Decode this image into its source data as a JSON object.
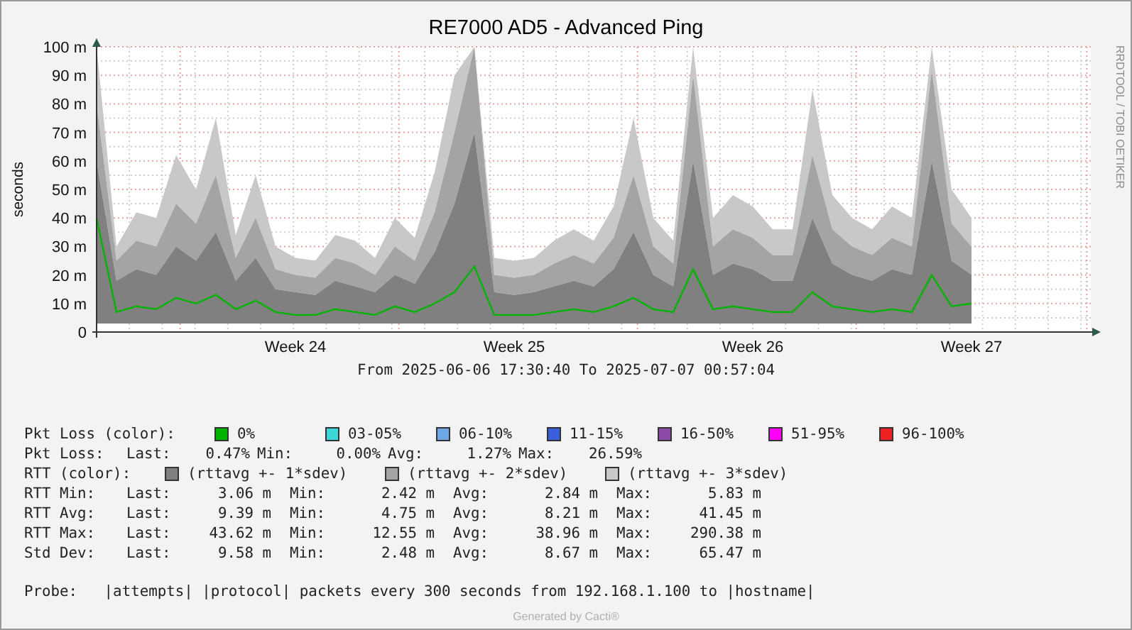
{
  "graph": {
    "title": "RE7000 AD5 - Advanced Ping",
    "side_credit": "RRDTOOL / TOBI OETIKER",
    "period": "From 2025-06-06 17:30:40 To 2025-07-07 00:57:04",
    "chart_data": {
      "type": "area",
      "ylabel": "seconds",
      "ylim": [
        0,
        100
      ],
      "grid": true,
      "yticks": [
        {
          "value": 0,
          "label": "0"
        },
        {
          "value": 10,
          "label": "10 m"
        },
        {
          "value": 20,
          "label": "20 m"
        },
        {
          "value": 30,
          "label": "30 m"
        },
        {
          "value": 40,
          "label": "40 m"
        },
        {
          "value": 50,
          "label": "50 m"
        },
        {
          "value": 60,
          "label": "60 m"
        },
        {
          "value": 70,
          "label": "70 m"
        },
        {
          "value": 80,
          "label": "80 m"
        },
        {
          "value": 90,
          "label": "90 m"
        },
        {
          "value": 100,
          "label": "100 m"
        }
      ],
      "categories": [
        null,
        null,
        null,
        null,
        null,
        null,
        null,
        null,
        null,
        null,
        "Week 24",
        null,
        null,
        null,
        null,
        null,
        null,
        null,
        null,
        null,
        null,
        "Week 25",
        null,
        null,
        null,
        null,
        null,
        null,
        null,
        null,
        null,
        null,
        null,
        "Week 26",
        null,
        null,
        null,
        null,
        null,
        null,
        null,
        null,
        null,
        null,
        "Week 27",
        null,
        null,
        null,
        null,
        null
      ],
      "series": [
        {
          "color": "#c8c8c8",
          "values": [
            100,
            30,
            42,
            40,
            62,
            50,
            75,
            34,
            55,
            30,
            26,
            25,
            34,
            32,
            26,
            40,
            33,
            56,
            90,
            100,
            26,
            25,
            26,
            32,
            36,
            32,
            44,
            75,
            40,
            32,
            100,
            40,
            48,
            44,
            36,
            36,
            85,
            48,
            40,
            36,
            44,
            40,
            100,
            50,
            40,
            null,
            null,
            null,
            null,
            null
          ]
        },
        {
          "color": "#a4a4a4",
          "values": [
            80,
            25,
            32,
            30,
            45,
            38,
            55,
            26,
            40,
            22,
            20,
            19,
            26,
            24,
            20,
            30,
            25,
            42,
            70,
            100,
            20,
            19,
            20,
            24,
            27,
            24,
            33,
            55,
            30,
            24,
            90,
            30,
            36,
            33,
            27,
            27,
            62,
            36,
            30,
            27,
            33,
            30,
            92,
            38,
            30,
            null,
            null,
            null,
            null,
            null
          ]
        },
        {
          "color": "#808080",
          "values": [
            60,
            18,
            22,
            20,
            30,
            25,
            35,
            18,
            26,
            15,
            14,
            13,
            18,
            16,
            14,
            20,
            17,
            28,
            45,
            70,
            14,
            13,
            14,
            16,
            18,
            16,
            22,
            35,
            20,
            16,
            60,
            20,
            24,
            22,
            18,
            18,
            40,
            24,
            20,
            18,
            22,
            20,
            60,
            25,
            20,
            null,
            null,
            null,
            null,
            null
          ]
        },
        {
          "type": "line",
          "color": "#00b400",
          "values": [
            40,
            7,
            9,
            8,
            12,
            10,
            13,
            8,
            11,
            7,
            6,
            6,
            8,
            7,
            6,
            9,
            7,
            10,
            14,
            23,
            6,
            6,
            6,
            7,
            8,
            7,
            9,
            12,
            8,
            7,
            22,
            8,
            9,
            8,
            7,
            7,
            14,
            9,
            8,
            7,
            8,
            7,
            20,
            9,
            10,
            null,
            null,
            null,
            null,
            null
          ]
        }
      ]
    }
  },
  "legend": {
    "loss_colors": {
      "label": "Pkt Loss (color):",
      "items": [
        {
          "label": "0%",
          "color": "#00b400"
        },
        {
          "label": "03-05%",
          "color": "#3cd6d6"
        },
        {
          "label": "06-10%",
          "color": "#6fa8e6"
        },
        {
          "label": "11-15%",
          "color": "#3a5fdc"
        },
        {
          "label": "16-50%",
          "color": "#8c4aa8"
        },
        {
          "label": "51-95%",
          "color": "#ff00ff"
        },
        {
          "label": "96-100%",
          "color": "#ee2222"
        }
      ]
    },
    "rtt_colors": {
      "label": "RTT (color):",
      "items": [
        {
          "label": "(rttavg +- 1*sdev)",
          "color": "#808080"
        },
        {
          "label": "(rttavg +- 2*sdev)",
          "color": "#a4a4a4"
        },
        {
          "label": "(rttavg +- 3*sdev)",
          "color": "#c8c8c8"
        }
      ]
    },
    "stats": [
      {
        "kind": "loss",
        "label": "Pkt Loss:",
        "values": [
          {
            "key": "Last:",
            "value": "0.47%"
          },
          {
            "key": "Min:",
            "value": "0.00%"
          },
          {
            "key": "Avg:",
            "value": "1.27%"
          },
          {
            "key": "Max:",
            "value": "26.59%"
          }
        ]
      },
      {
        "kind": "rtt",
        "label": "RTT Min:",
        "values": [
          {
            "key": "Last:",
            "value": "3.06 m"
          },
          {
            "key": "Min:",
            "value": "2.42 m"
          },
          {
            "key": "Avg:",
            "value": "2.84 m"
          },
          {
            "key": "Max:",
            "value": "5.83 m"
          }
        ]
      },
      {
        "kind": "rtt",
        "label": "RTT Avg:",
        "values": [
          {
            "key": "Last:",
            "value": "9.39 m"
          },
          {
            "key": "Min:",
            "value": "4.75 m"
          },
          {
            "key": "Avg:",
            "value": "8.21 m"
          },
          {
            "key": "Max:",
            "value": "41.45 m"
          }
        ]
      },
      {
        "kind": "rtt",
        "label": "RTT Max:",
        "values": [
          {
            "key": "Last:",
            "value": "43.62 m"
          },
          {
            "key": "Min:",
            "value": "12.55 m"
          },
          {
            "key": "Avg:",
            "value": "38.96 m"
          },
          {
            "key": "Max:",
            "value": "290.38 m"
          }
        ]
      },
      {
        "kind": "rtt",
        "label": "Std Dev:",
        "values": [
          {
            "key": "Last:",
            "value": "9.58 m"
          },
          {
            "key": "Min:",
            "value": "2.48 m"
          },
          {
            "key": "Avg:",
            "value": "8.67 m"
          },
          {
            "key": "Max:",
            "value": "65.47 m"
          }
        ]
      }
    ]
  },
  "probe": "Probe:   |attempts| |protocol| packets every 300 seconds from 192.168.1.100 to |hostname|",
  "footer": "Generated by Cacti®"
}
